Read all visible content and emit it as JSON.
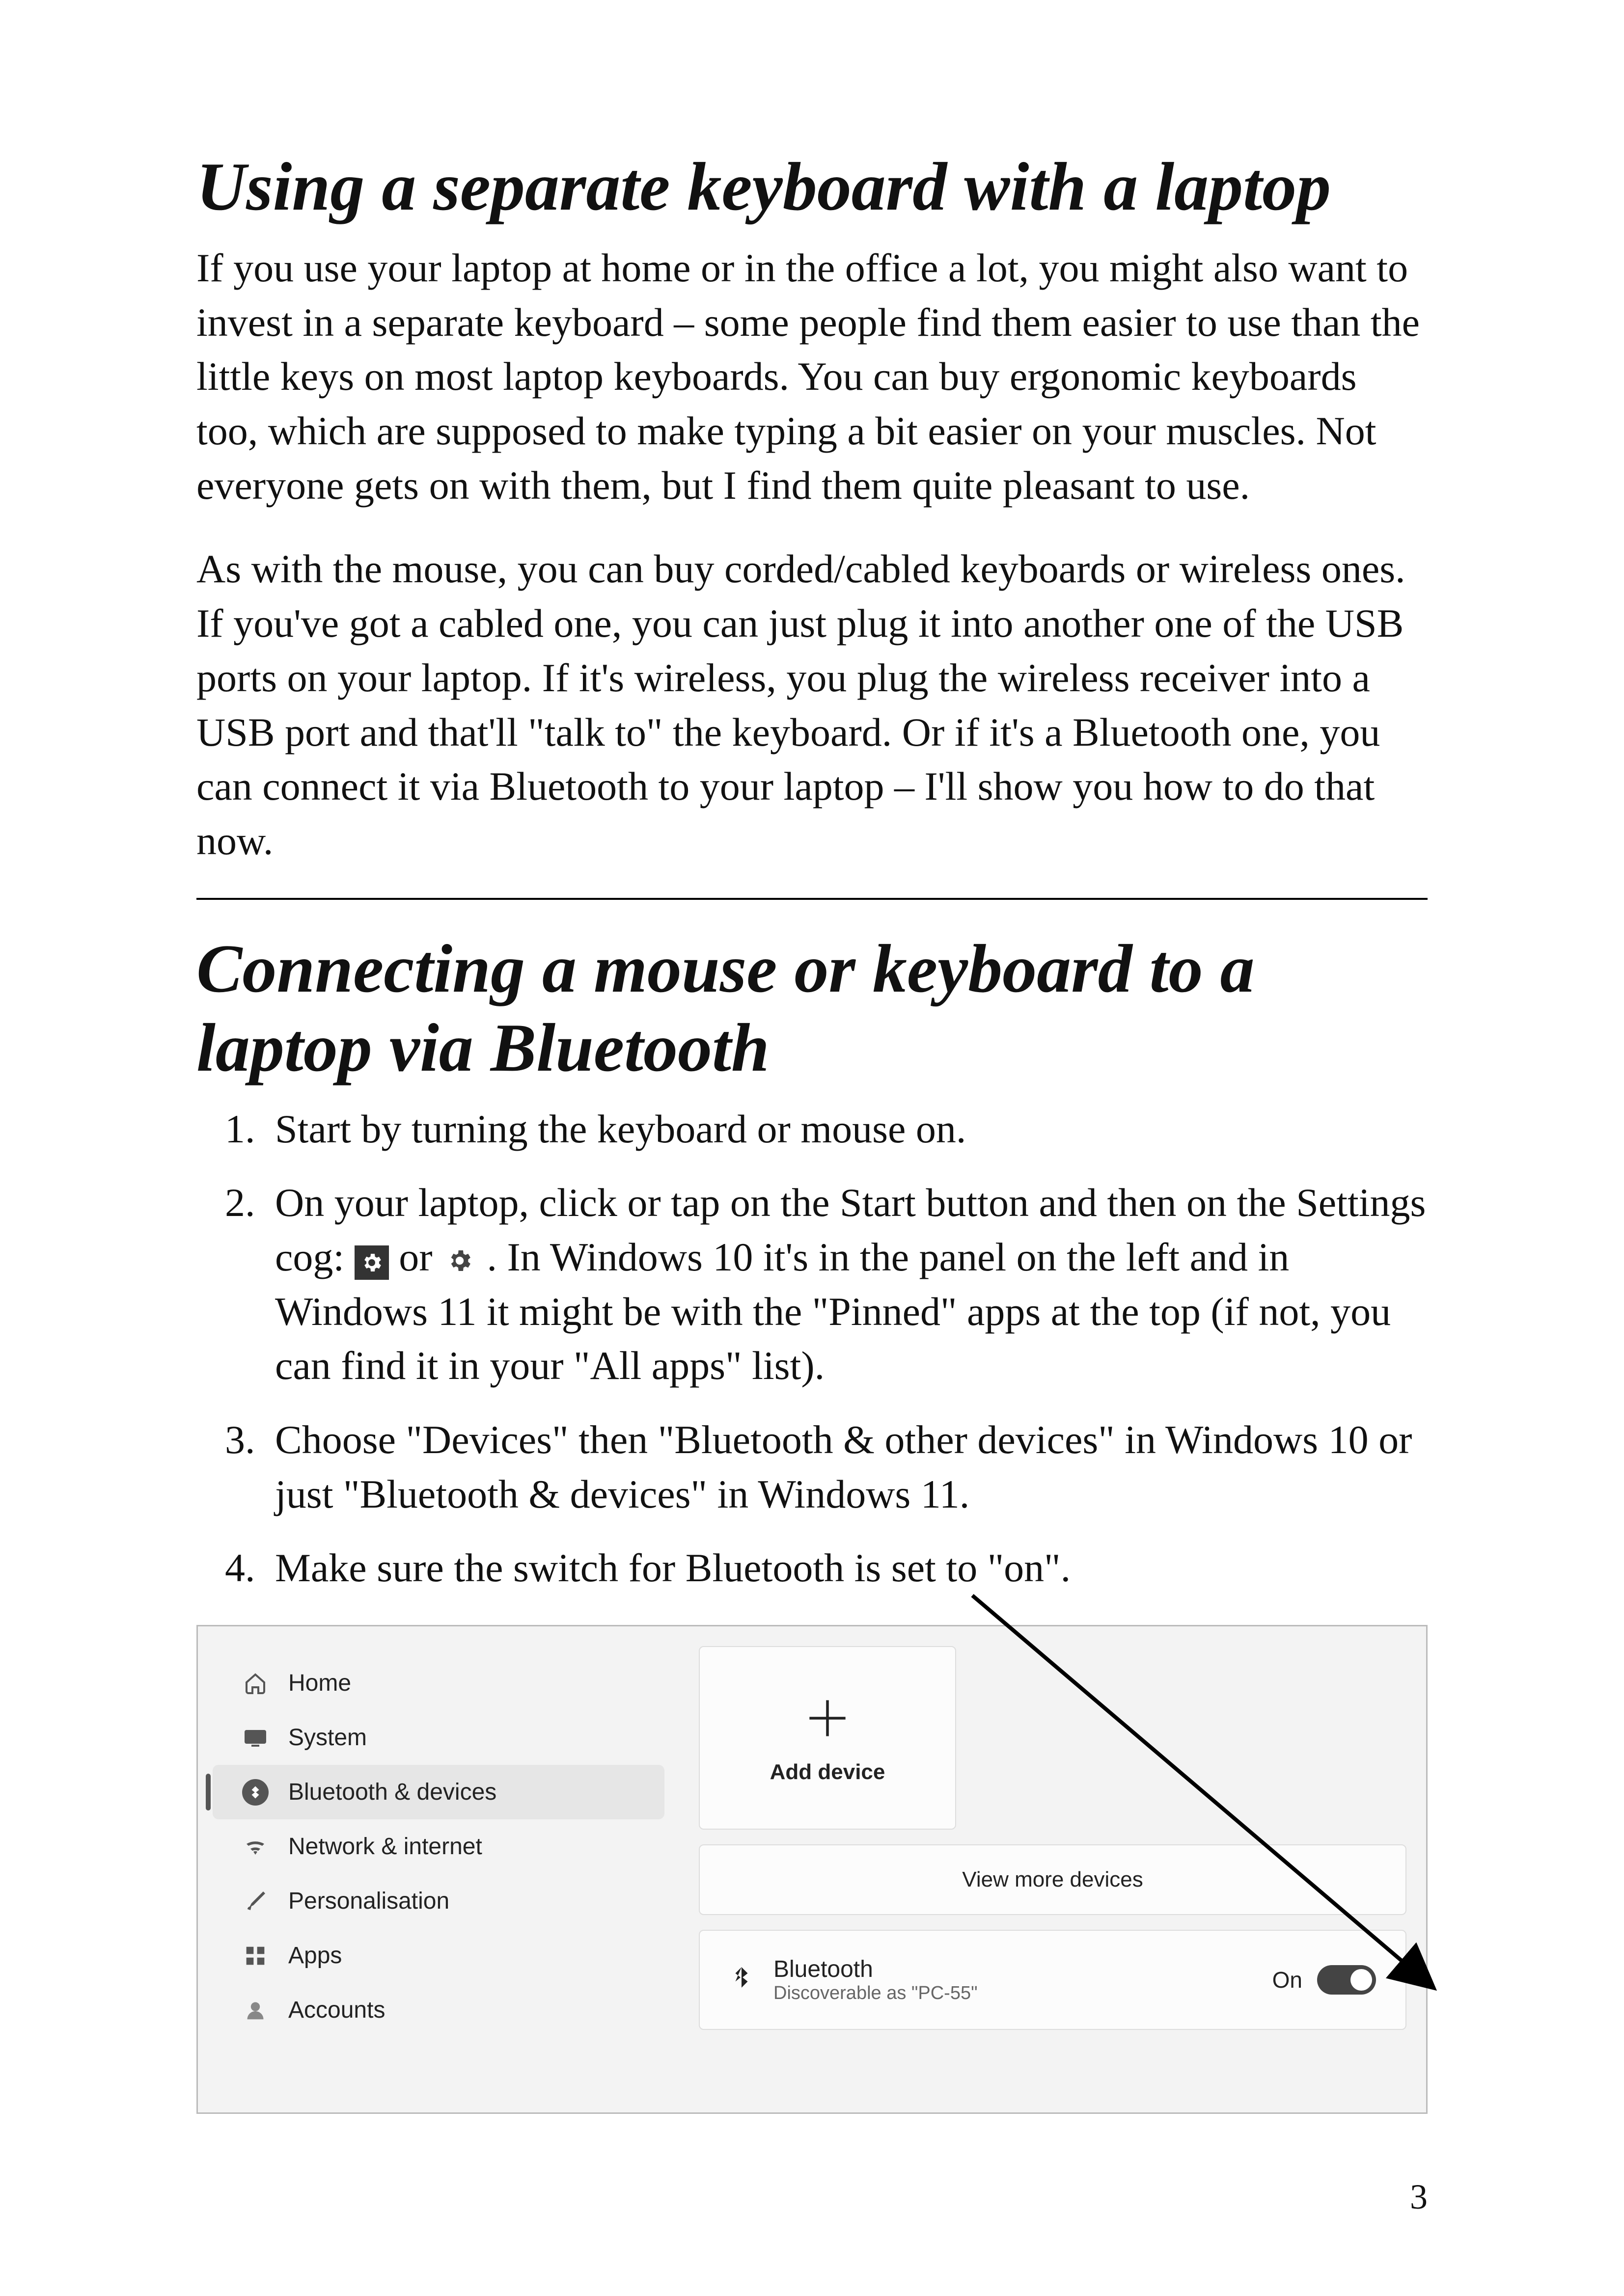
{
  "page_number": "3",
  "section1": {
    "heading": "Using a separate keyboard with a laptop",
    "para1": "If you use your laptop at home or in the office a lot, you might also want to invest in a separate keyboard – some people find them easier to use than the little keys on most laptop keyboards.  You can buy ergonomic keyboards too, which are supposed to make typing a bit easier on your muscles.  Not everyone gets on with them, but I find them quite pleasant to use.",
    "para2": "As with the mouse, you can buy corded/cabled keyboards or wireless ones.  If you've got a cabled one, you can just plug it into another one of the USB ports on your laptop.  If it's wireless, you plug the wireless receiver into a USB port and that'll \"talk to\" the keyboard.  Or if it's a Bluetooth one, you can connect it via Bluetooth to your laptop – I'll show you how to do that now."
  },
  "section2": {
    "heading": "Connecting a mouse or keyboard to a laptop via Bluetooth",
    "steps": {
      "s1": "Start by turning the keyboard or mouse on.",
      "s2a": "On your laptop, click or tap on the Start button and then on the Settings cog: ",
      "s2_or": " or ",
      "s2b": " .  In Windows 10 it's in the panel on the left and in Windows 11 it might be with the \"Pinned\" apps at the top (if not, you can find it in your \"All apps\" list).",
      "s3": "Choose \"Devices\" then \"Bluetooth & other devices\" in Windows 10 or just \"Bluetooth & devices\" in Windows 11.",
      "s4": "Make sure the switch for Bluetooth is set to \"on\"."
    }
  },
  "windows": {
    "sidebar": {
      "home": "Home",
      "system": "System",
      "bluetooth": "Bluetooth & devices",
      "network": "Network & internet",
      "personalisation": "Personalisation",
      "apps": "Apps",
      "accounts": "Accounts"
    },
    "add_device": "Add device",
    "view_more": "View more devices",
    "bt_title": "Bluetooth",
    "bt_sub": "Discoverable as \"PC-55\"",
    "bt_state": "On"
  }
}
